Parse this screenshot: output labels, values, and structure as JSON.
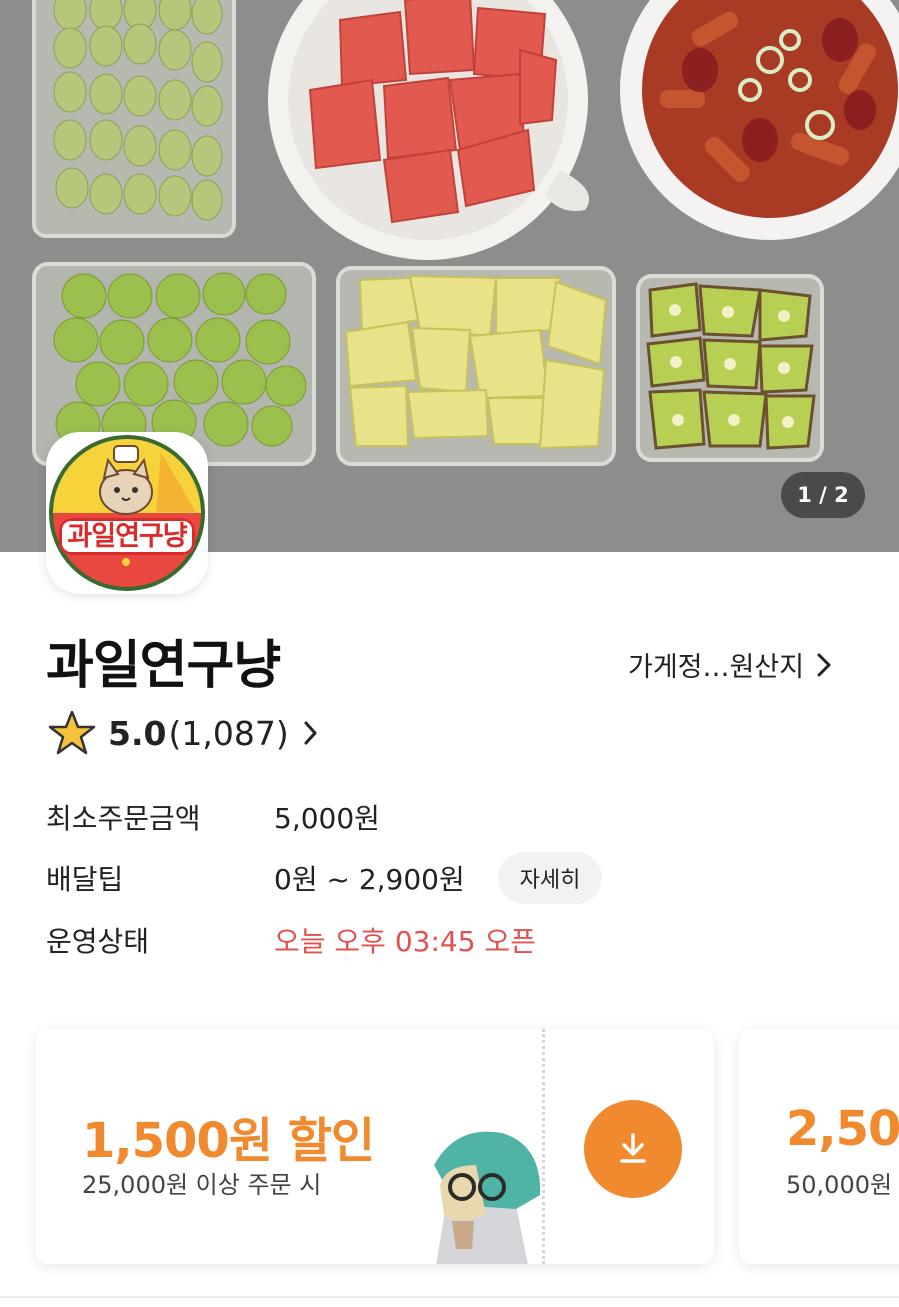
{
  "hero": {
    "page_indicator": "1 / 2"
  },
  "logo": {
    "text": "과일연구냥"
  },
  "store": {
    "name": "과일연구냥",
    "info_link": "가게정…원산지"
  },
  "rating": {
    "score": "5.0",
    "count": "(1,087)"
  },
  "info": {
    "min_order_label": "최소주문금액",
    "min_order_value": "5,000원",
    "delivery_tip_label": "배달팁",
    "delivery_tip_value": "0원 ~ 2,900원",
    "detail_button": "자세히",
    "status_label": "운영상태",
    "status_value": "오늘 오후 03:45 오픈"
  },
  "coupons": [
    {
      "amount": "1,500원 할인",
      "condition": "25,000원 이상 주문 시"
    },
    {
      "amount": "2,50",
      "condition": "50,000원"
    }
  ],
  "colors": {
    "accent": "#f1892e",
    "status_red": "#e1514f",
    "star": "#f5c33b"
  },
  "icons": {
    "star": "star-icon",
    "chevron": "chevron-right-icon",
    "download": "download-icon"
  }
}
